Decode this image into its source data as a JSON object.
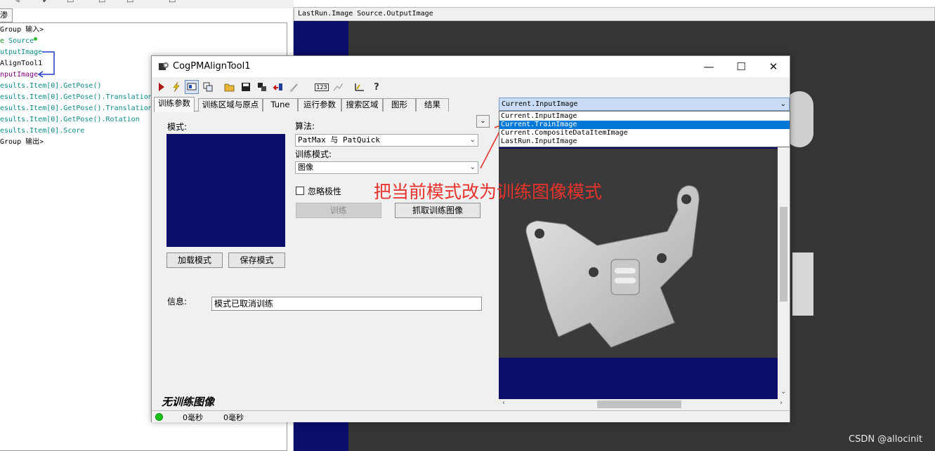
{
  "background_app": {
    "tree_tab_label": "渗",
    "tree_lines": [
      {
        "text": "Group 输入>",
        "color": "black"
      },
      {
        "text": "Source",
        "color": "teal"
      },
      {
        "text": "utputImage",
        "color": "teal"
      },
      {
        "text": "AlignTool1",
        "color": "black"
      },
      {
        "text": "nputImage",
        "color": "purple"
      },
      {
        "text": "esults.Item[0].GetPose()",
        "color": "teal"
      },
      {
        "text": "esults.Item[0].GetPose().TranslationX",
        "color": "teal"
      },
      {
        "text": "esults.Item[0].GetPose().TranslationY",
        "color": "teal"
      },
      {
        "text": "esults.Item[0].GetPose().Rotation",
        "color": "teal"
      },
      {
        "text": "esults.Item[0].Score",
        "color": "teal"
      },
      {
        "text": "Group 输出>",
        "color": "black"
      }
    ],
    "display_header": "LastRun.Image Source.OutputImage"
  },
  "dialog": {
    "title": "CogPMAlignTool1",
    "window_buttons": {
      "minimize": "—",
      "maximize": "☐",
      "close": "✕"
    },
    "toolbar_icons": [
      "run-icon",
      "electric-icon",
      "display-icon",
      "copy-icon",
      "open-icon",
      "save-icon",
      "save-as-icon",
      "reset-icon",
      "brush-icon",
      "numeric-icon",
      "graph-icon",
      "ruler-icon",
      "help-icon"
    ],
    "toolbar_glyphs": {
      "help": "?",
      "numeric": "123"
    },
    "tabs": [
      "训练参数",
      "训练区域与原点",
      "Tune",
      "运行参数",
      "搜索区域",
      "图形",
      "结果"
    ],
    "active_tab": 0,
    "train_params": {
      "model_label": "模式:",
      "algorithm_label": "算法:",
      "algorithm_value": "PatMax 与 PatQuick",
      "train_mode_label": "训练模式:",
      "train_mode_value": "图像",
      "ignore_polarity_label": "忽略极性",
      "ignore_polarity_checked": false,
      "train_button": "训练",
      "grab_button": "抓取训练图像",
      "load_button": "加载模式",
      "save_button": "保存模式",
      "info_label": "信息:",
      "info_value": "模式已取消训练",
      "no_train_text": "无训练图像",
      "expand_glyph": "⌄"
    },
    "view": {
      "selected_value": "Current.InputImage",
      "options": [
        "Current.InputImage",
        "Current.TrainImage",
        "Current.CompositeDataItemImage",
        "LastRun.InputImage"
      ],
      "highlighted_option": 1
    },
    "status": {
      "led_color": "#18c418",
      "time1": "0毫秒",
      "time2": "0毫秒"
    }
  },
  "annotation": {
    "text": "把当前模式改为训练图像模式",
    "color": "#e8322c"
  },
  "watermark": "CSDN @allocinit"
}
